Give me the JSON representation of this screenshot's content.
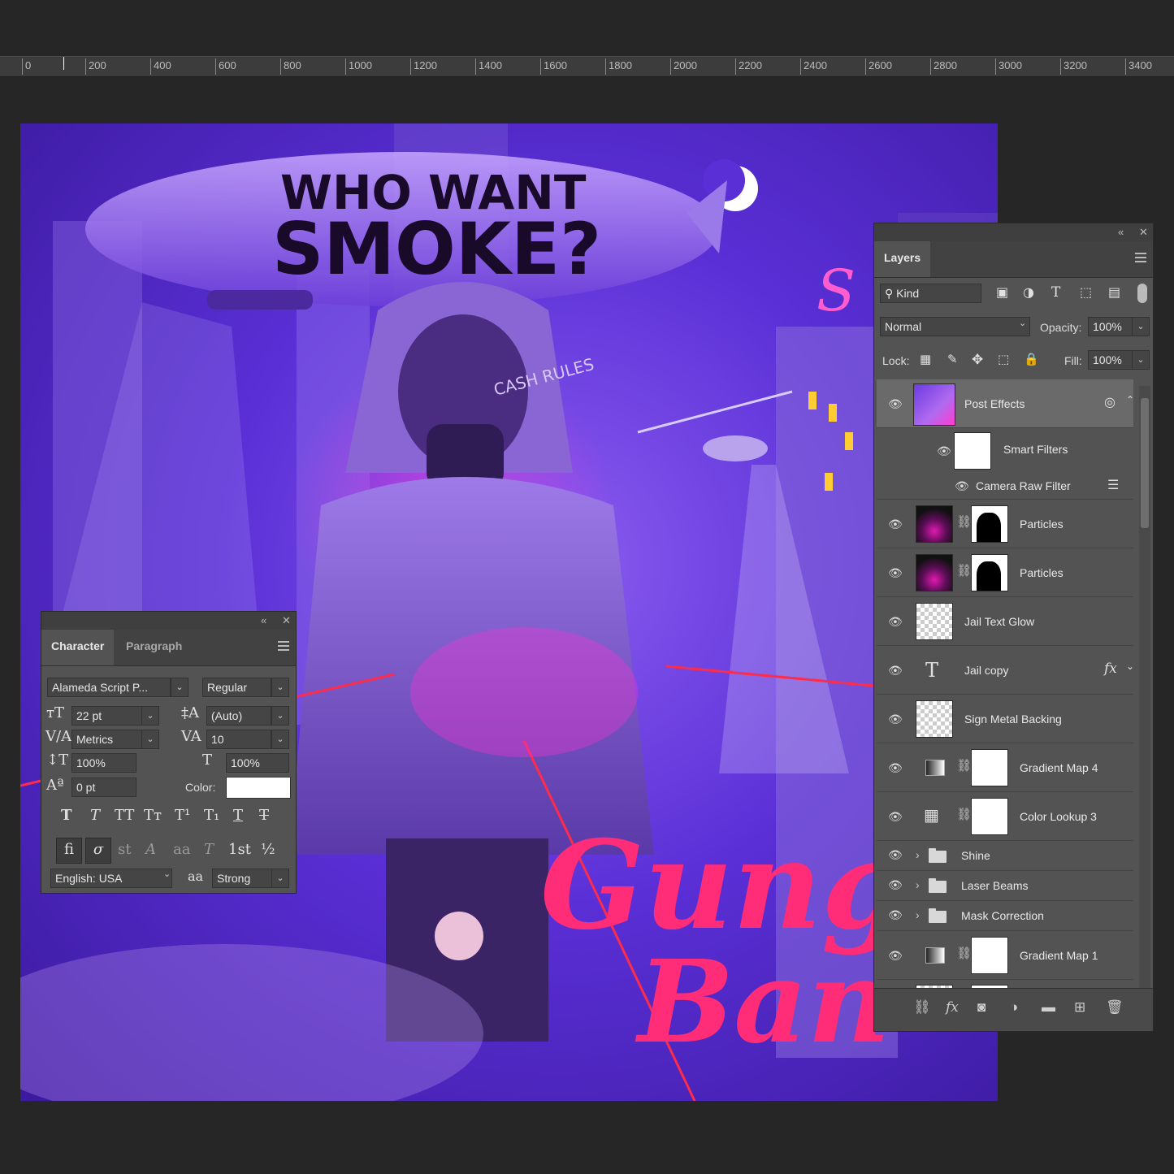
{
  "ruler": {
    "labels": [
      "0",
      "200",
      "400",
      "600",
      "800",
      "1000",
      "1200",
      "1400",
      "1600",
      "1800",
      "2000",
      "2200",
      "2400",
      "2600",
      "2800",
      "3000",
      "3200",
      "3400"
    ]
  },
  "artwork": {
    "blimp_text_line1": "WHO WANT",
    "blimp_text_line2": "SMOKE?",
    "hat_text": "CASH RULES",
    "script_text_line1": "Gung",
    "script_text_line2": "Ban",
    "colors": {
      "background": "#5a2fd6",
      "neon": "#ff2d78",
      "laser": "#ff1e3c"
    }
  },
  "character_panel": {
    "tabs": [
      "Character",
      "Paragraph"
    ],
    "font_family": "Alameda Script P...",
    "font_style": "Regular",
    "font_size": "22 pt",
    "leading": "(Auto)",
    "kerning": "Metrics",
    "tracking": "10",
    "vertical_scale": "100%",
    "horizontal_scale": "100%",
    "baseline_shift": "0 pt",
    "color_label": "Color:",
    "color_value": "#ffffff",
    "language": "English: USA",
    "antialias_label": "aa",
    "antialias": "Strong",
    "style_buttons": [
      "T",
      "T",
      "TT",
      "Tт",
      "T¹",
      "T₁",
      "T",
      "T"
    ],
    "opentype_buttons": [
      "fi",
      "σ",
      "st",
      "A",
      "aa",
      "T",
      "1st",
      "½"
    ]
  },
  "layers_panel": {
    "title": "Layers",
    "filter_kind": "Kind",
    "blend_mode": "Normal",
    "opacity_label": "Opacity:",
    "opacity": "100%",
    "lock_label": "Lock:",
    "fill_label": "Fill:",
    "fill": "100%",
    "layers": [
      {
        "name": "Post Effects",
        "type": "smart-object",
        "selected": true
      },
      {
        "name": "Smart Filters",
        "type": "smart-filters"
      },
      {
        "name": "Camera Raw Filter",
        "type": "filter"
      },
      {
        "name": "Particles",
        "type": "masked"
      },
      {
        "name": "Particles",
        "type": "masked"
      },
      {
        "name": "Jail Text Glow",
        "type": "pixel"
      },
      {
        "name": "Jail copy",
        "type": "text",
        "fx": "fx"
      },
      {
        "name": "Sign Metal Backing",
        "type": "pixel"
      },
      {
        "name": "Gradient Map 4",
        "type": "adjustment-gradient"
      },
      {
        "name": "Color Lookup 3",
        "type": "adjustment-lookup"
      },
      {
        "name": "Shine",
        "type": "group"
      },
      {
        "name": "Laser Beams",
        "type": "group"
      },
      {
        "name": "Mask Correction",
        "type": "group"
      },
      {
        "name": "Gradient Map 1",
        "type": "adjustment-gradient"
      }
    ]
  }
}
